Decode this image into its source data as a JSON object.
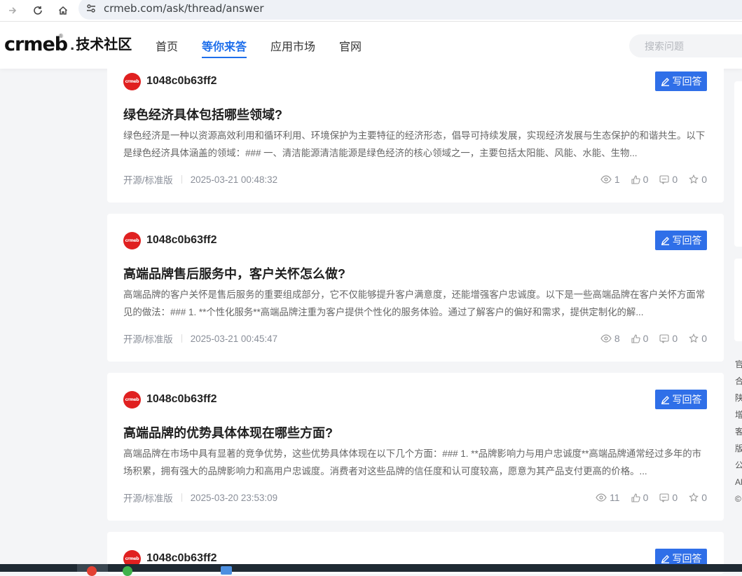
{
  "browser": {
    "url": "crmeb.com/ask/thread/answer"
  },
  "header": {
    "logo_text": "crmeb",
    "logo_suffix": "技术社区",
    "nav": [
      {
        "label": "首页",
        "active": false
      },
      {
        "label": "等你来答",
        "active": true
      },
      {
        "label": "应用市场",
        "active": false
      },
      {
        "label": "官网",
        "active": false
      }
    ],
    "search_placeholder": "搜索问题"
  },
  "answer_button_label": "写回答",
  "questions": [
    {
      "user": "1048c0b63ff2",
      "title": "绿色经济具体包括哪些领域?",
      "excerpt": "绿色经济是一种以资源高效利用和循环利用、环境保护为主要特征的经济形态，倡导可持续发展，实现经济发展与生态保护的和谐共生。以下是绿色经济具体涵盖的领域：### 一、清洁能源清洁能源是绿色经济的核心领域之一，主要包括太阳能、风能、水能、生物...",
      "tag": "开源/标准版",
      "time": "2025-03-21 00:48:32",
      "views": "1",
      "likes": "0",
      "comments": "0",
      "stars": "0"
    },
    {
      "user": "1048c0b63ff2",
      "title": "高端品牌售后服务中，客户关怀怎么做?",
      "excerpt": "高端品牌的客户关怀是售后服务的重要组成部分，它不仅能够提升客户满意度，还能增强客户忠诚度。以下是一些高端品牌在客户关怀方面常见的做法：### 1. **个性化服务**高端品牌注重为客户提供个性化的服务体验。通过了解客户的偏好和需求，提供定制化的解...",
      "tag": "开源/标准版",
      "time": "2025-03-21 00:45:47",
      "views": "8",
      "likes": "0",
      "comments": "0",
      "stars": "0"
    },
    {
      "user": "1048c0b63ff2",
      "title": "高端品牌的优势具体体现在哪些方面?",
      "excerpt": "高端品牌在市场中具有显著的竞争优势，这些优势具体体现在以下几个方面：### 1. **品牌影响力与用户忠诚度**高端品牌通常经过多年的市场积累，拥有强大的品牌影响力和高用户忠诚度。消费者对这些品牌的信任度和认可度较高，愿意为其产品支付更高的价格。...",
      "tag": "开源/标准版",
      "time": "2025-03-20 23:53:09",
      "views": "11",
      "likes": "0",
      "comments": "0",
      "stars": "0"
    },
    {
      "user": "1048c0b63ff2"
    }
  ],
  "sidebar_links": [
    "官",
    "合",
    "陕",
    "增",
    "客",
    "版",
    "公",
    "Al",
    "©"
  ],
  "colors": {
    "accent": "#2f6fe8",
    "avatar": "#e02020"
  }
}
